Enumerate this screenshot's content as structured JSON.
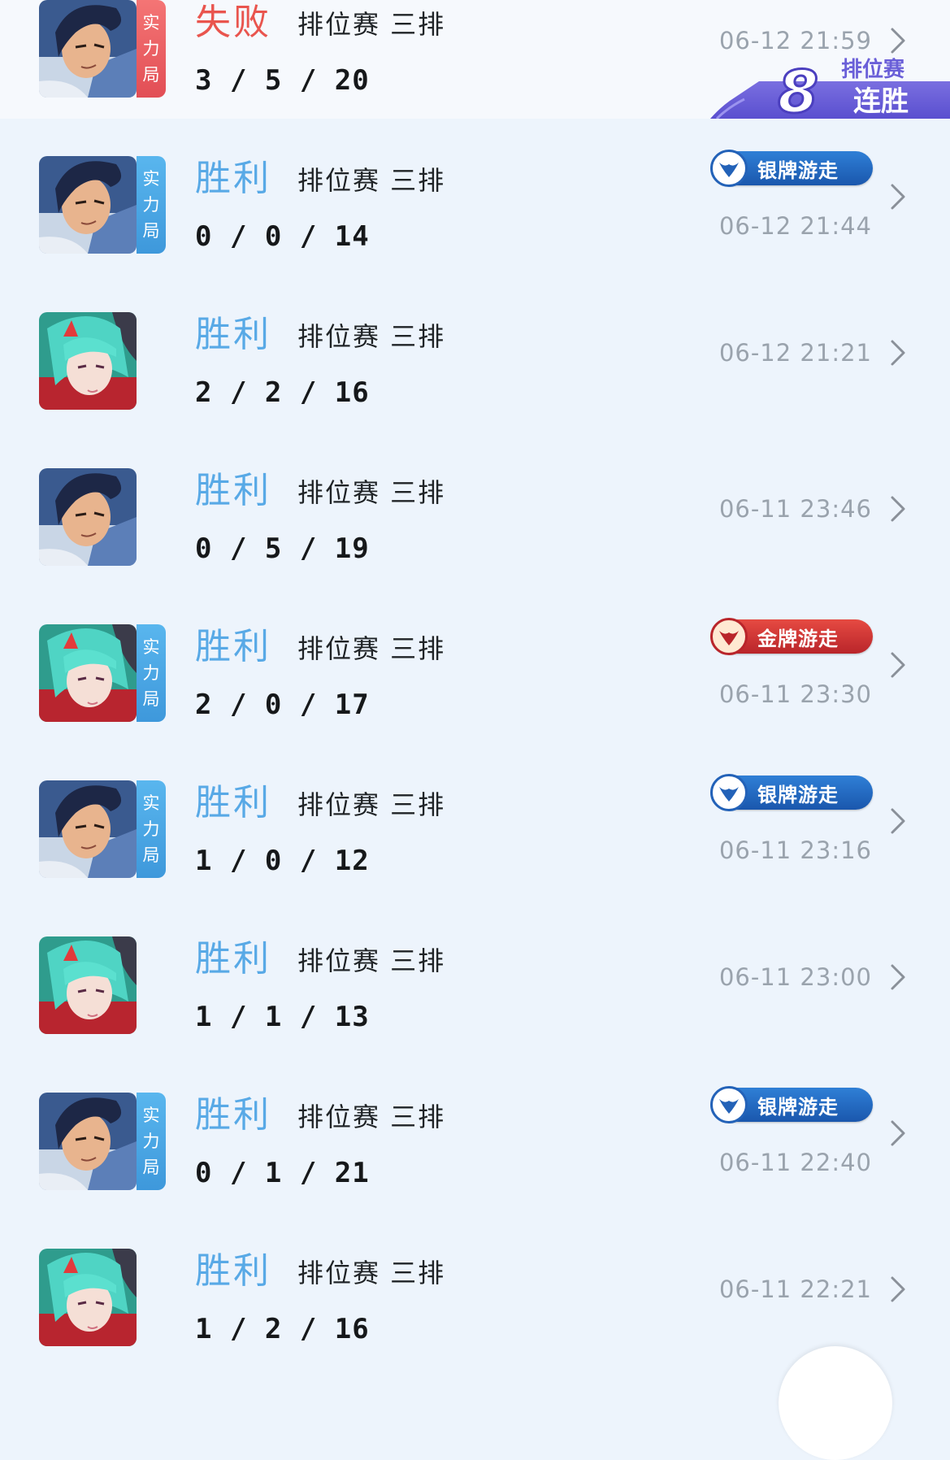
{
  "streak": {
    "count": "8",
    "label_top": "排位赛",
    "label_bottom": "连胜"
  },
  "matches": [
    {
      "hero": "warrior",
      "tag": [
        "实",
        "力",
        "局"
      ],
      "tag_color": "red",
      "result": "失败",
      "mode": "排位赛 三排",
      "kda": "3 / 5 / 20",
      "time": "06-12 21:59",
      "badge": null
    },
    {
      "hero": "warrior",
      "tag": [
        "实",
        "力",
        "局"
      ],
      "tag_color": "blue",
      "result": "胜利",
      "mode": "排位赛 三排",
      "kda": "0 / 0 / 14",
      "time": "06-12 21:44",
      "badge": {
        "type": "silver",
        "label": "银牌游走"
      }
    },
    {
      "hero": "mage",
      "tag": null,
      "tag_color": null,
      "result": "胜利",
      "mode": "排位赛 三排",
      "kda": "2 / 2 / 16",
      "time": "06-12 21:21",
      "badge": null
    },
    {
      "hero": "warrior",
      "tag": null,
      "tag_color": null,
      "result": "胜利",
      "mode": "排位赛 三排",
      "kda": "0 / 5 / 19",
      "time": "06-11 23:46",
      "badge": null
    },
    {
      "hero": "mage",
      "tag": [
        "实",
        "力",
        "局"
      ],
      "tag_color": "blue",
      "result": "胜利",
      "mode": "排位赛 三排",
      "kda": "2 / 0 / 17",
      "time": "06-11 23:30",
      "badge": {
        "type": "gold",
        "label": "金牌游走"
      }
    },
    {
      "hero": "warrior",
      "tag": [
        "实",
        "力",
        "局"
      ],
      "tag_color": "blue",
      "result": "胜利",
      "mode": "排位赛 三排",
      "kda": "1 / 0 / 12",
      "time": "06-11 23:16",
      "badge": {
        "type": "silver",
        "label": "银牌游走"
      }
    },
    {
      "hero": "mage",
      "tag": null,
      "tag_color": null,
      "result": "胜利",
      "mode": "排位赛 三排",
      "kda": "1 / 1 / 13",
      "time": "06-11 23:00",
      "badge": null
    },
    {
      "hero": "warrior",
      "tag": [
        "实",
        "力",
        "局"
      ],
      "tag_color": "blue",
      "result": "胜利",
      "mode": "排位赛 三排",
      "kda": "0 / 1 / 21",
      "time": "06-11 22:40",
      "badge": {
        "type": "silver",
        "label": "银牌游走"
      }
    },
    {
      "hero": "mage",
      "tag": null,
      "tag_color": null,
      "result": "胜利",
      "mode": "排位赛 三排",
      "kda": "1 / 2 / 16",
      "time": "06-11 22:21",
      "badge": null
    }
  ],
  "colors": {
    "win": "#58a9e6",
    "loss": "#e9554e",
    "silver_badge": "#1f63bd",
    "gold_badge": "#cf3434",
    "background": "#edf4fc"
  }
}
